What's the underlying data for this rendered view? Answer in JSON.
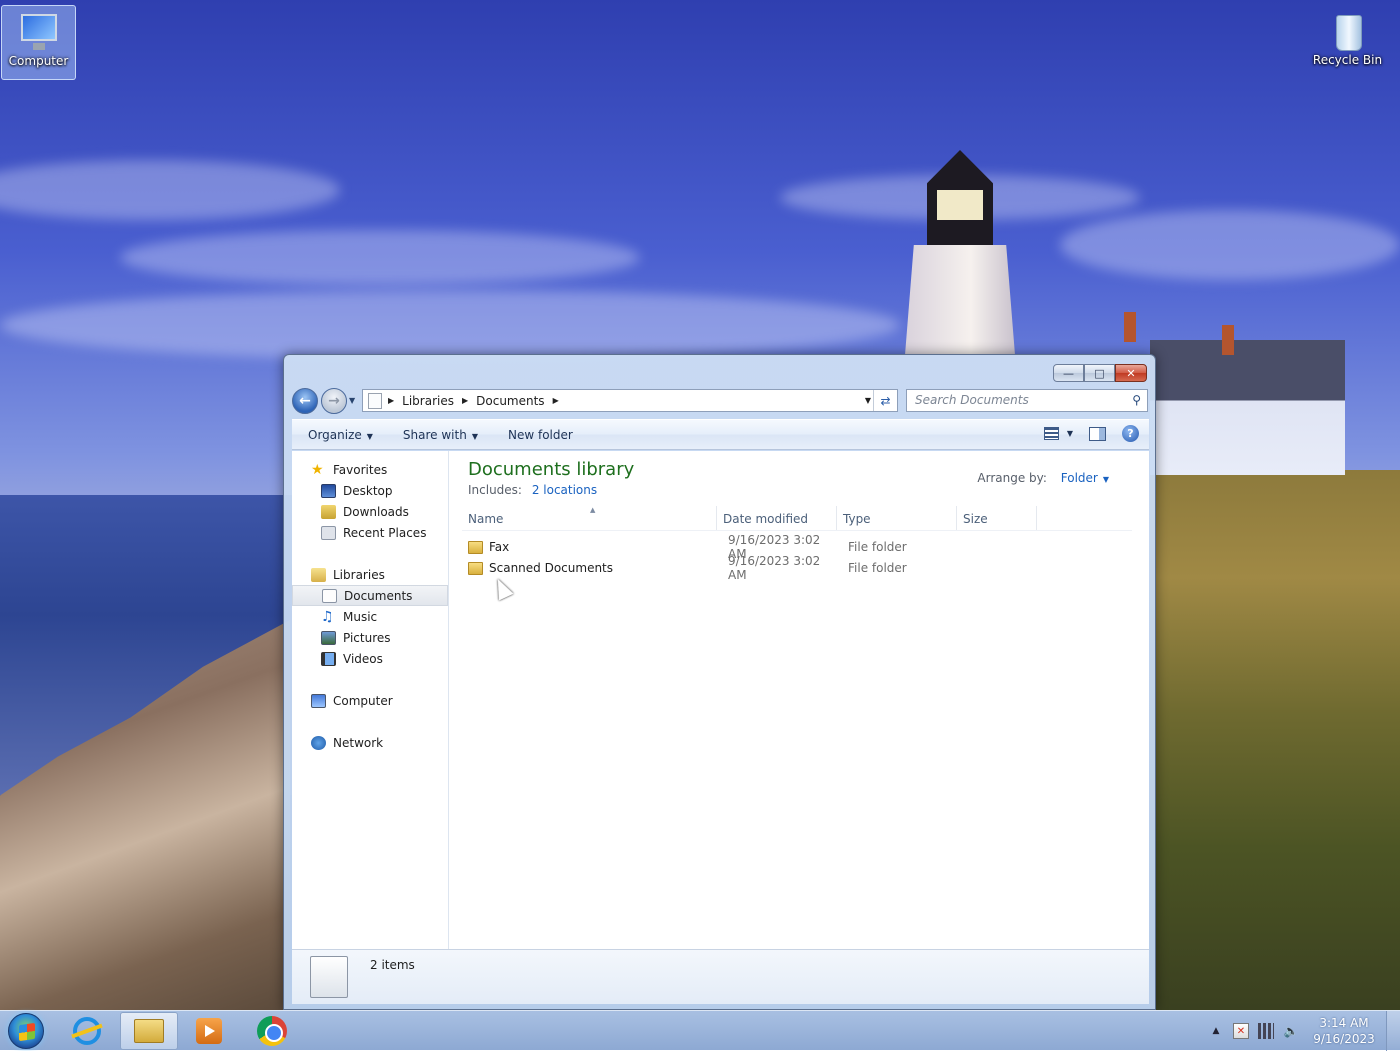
{
  "desktop": {
    "icons": [
      {
        "label": "Computer",
        "icon": "computer-icon"
      },
      {
        "label": "Recycle Bin",
        "icon": "recycle-bin-icon"
      }
    ]
  },
  "window": {
    "title": "Documents",
    "address": {
      "crumbs": [
        "Libraries",
        "Documents"
      ]
    },
    "search": {
      "placeholder": "Search Documents"
    },
    "toolbar": {
      "organize": "Organize",
      "share_with": "Share with",
      "new_folder": "New folder"
    },
    "nav": {
      "favorites": "Favorites",
      "desktop": "Desktop",
      "downloads": "Downloads",
      "recent_places": "Recent Places",
      "libraries": "Libraries",
      "documents": "Documents",
      "music": "Music",
      "pictures": "Pictures",
      "videos": "Videos",
      "computer": "Computer",
      "network": "Network"
    },
    "library": {
      "title": "Documents library",
      "includes_label": "Includes:",
      "locations": "2 locations",
      "arrange_label": "Arrange by:",
      "arrange_value": "Folder"
    },
    "columns": {
      "name": "Name",
      "date": "Date modified",
      "type": "Type",
      "size": "Size"
    },
    "files": [
      {
        "name": "Fax",
        "date": "9/16/2023 3:02 AM",
        "type": "File folder"
      },
      {
        "name": "Scanned Documents",
        "date": "9/16/2023 3:02 AM",
        "type": "File folder"
      }
    ],
    "status": {
      "count": "2 items"
    }
  },
  "taskbar": {
    "apps": [
      "internet-explorer-icon",
      "windows-explorer-icon",
      "media-player-icon",
      "chrome-icon"
    ],
    "clock": {
      "time": "3:14 AM",
      "date": "9/16/2023"
    }
  }
}
